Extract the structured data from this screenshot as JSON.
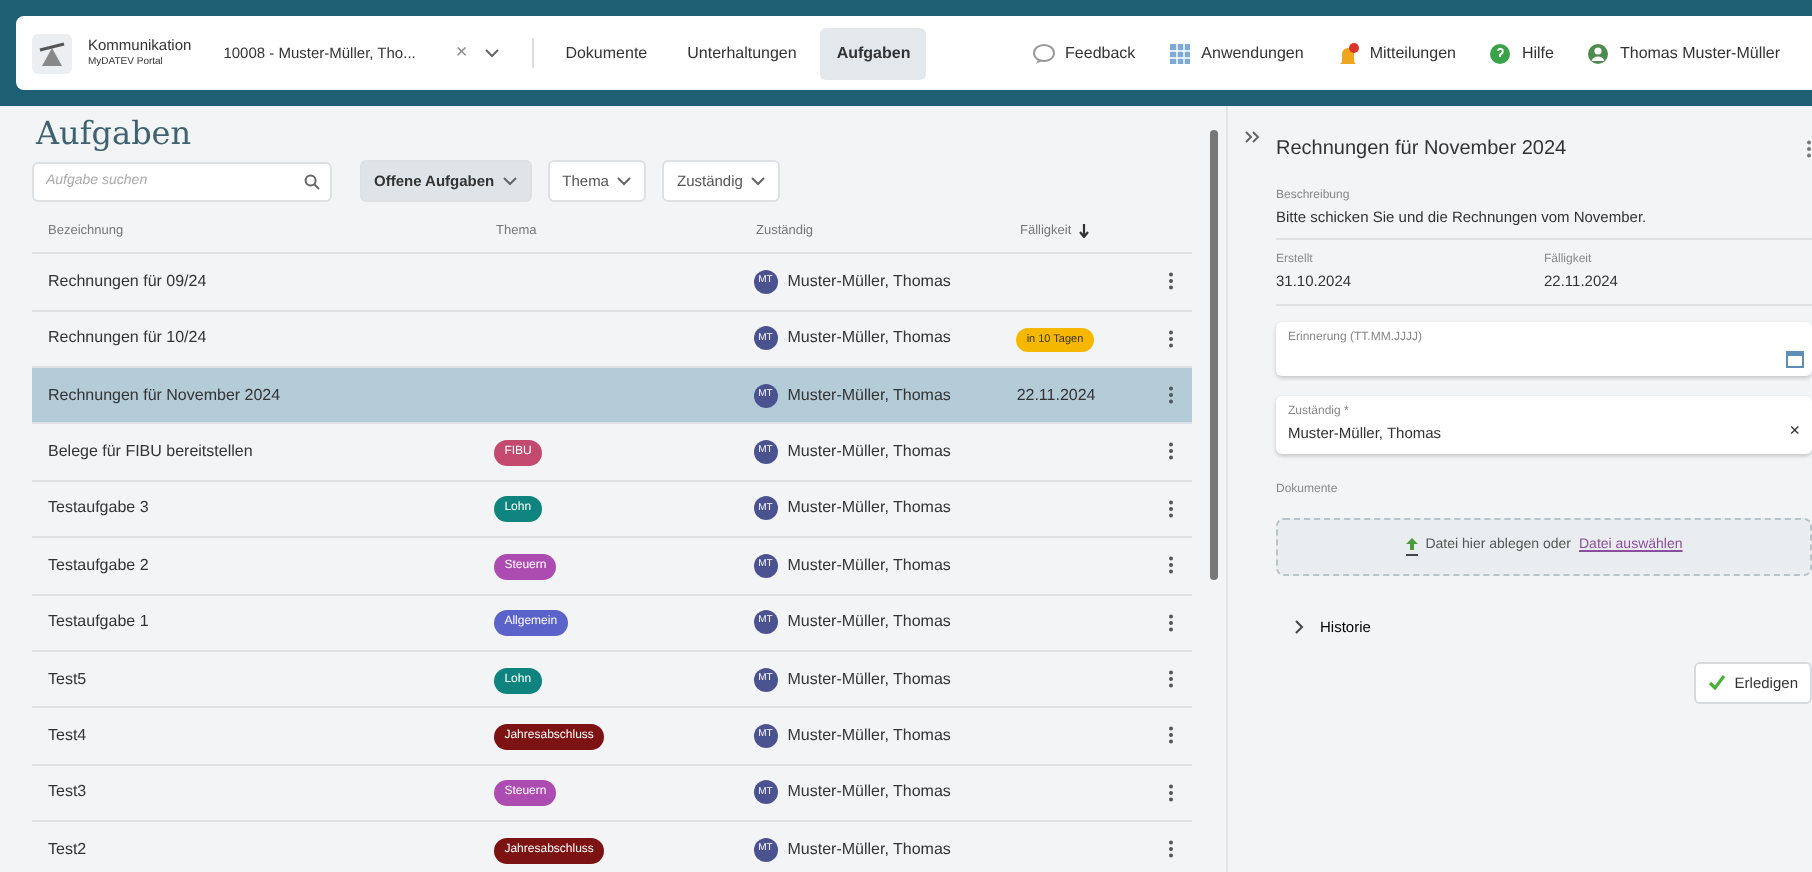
{
  "app": {
    "title": "Kommunikation",
    "subtitle": "MyDATEV Portal"
  },
  "client_selector": {
    "value": "10008 - Muster-Müller, Tho...",
    "clear": "×"
  },
  "nav_tabs": [
    {
      "label": "Dokumente",
      "selected": false
    },
    {
      "label": "Unterhaltungen",
      "selected": false
    },
    {
      "label": "Aufgaben",
      "selected": true
    }
  ],
  "header_actions": [
    {
      "label": "Feedback",
      "kind": "feedback"
    },
    {
      "label": "Anwendungen",
      "kind": "apps"
    },
    {
      "label": "Mitteilungen",
      "kind": "notifications"
    },
    {
      "label": "Hilfe",
      "kind": "help"
    },
    {
      "label": "Thomas Muster-Müller",
      "kind": "user"
    }
  ],
  "page_title": "Aufgaben",
  "search": {
    "placeholder": "Aufgabe suchen"
  },
  "filters": [
    {
      "label": "Offene Aufgaben",
      "selected": true
    },
    {
      "label": "Thema",
      "selected": false
    },
    {
      "label": "Zuständig",
      "selected": false
    }
  ],
  "table": {
    "columns": [
      "Bezeichnung",
      "Thema",
      "Zuständig",
      "Fälligkeit"
    ],
    "rows": [
      {
        "name": "Rechnungen für 09/24",
        "assignee": {
          "initials": "MT",
          "name": "Muster-Müller, Thomas"
        },
        "selected": false
      },
      {
        "name": "Rechnungen für 10/24",
        "assignee": {
          "initials": "MT",
          "name": "Muster-Müller, Thomas"
        },
        "due": {
          "text": "in 10 Tagen",
          "kind": "badge"
        },
        "selected": false
      },
      {
        "name": "Rechnungen für November 2024",
        "assignee": {
          "initials": "MT",
          "name": "Muster-Müller, Thomas"
        },
        "due": {
          "text": "22.11.2024",
          "kind": "plain"
        },
        "selected": true
      },
      {
        "name": "Belege für FIBU bereitstellen",
        "tag": {
          "label": "FIBU",
          "color": "#c4496e"
        },
        "assignee": {
          "initials": "MT",
          "name": "Muster-Müller, Thomas"
        },
        "selected": false
      },
      {
        "name": "Testaufgabe 3",
        "tag": {
          "label": "Lohn",
          "color": "#0f847e"
        },
        "assignee": {
          "initials": "MT",
          "name": "Muster-Müller, Thomas"
        },
        "selected": false
      },
      {
        "name": "Testaufgabe 2",
        "tag": {
          "label": "Steuern",
          "color": "#ad4cb0"
        },
        "assignee": {
          "initials": "MT",
          "name": "Muster-Müller, Thomas"
        },
        "selected": false
      },
      {
        "name": "Testaufgabe 1",
        "tag": {
          "label": "Allgemein",
          "color": "#5b62c9"
        },
        "assignee": {
          "initials": "MT",
          "name": "Muster-Müller, Thomas"
        },
        "selected": false
      },
      {
        "name": "Test5",
        "tag": {
          "label": "Lohn",
          "color": "#0f847e"
        },
        "assignee": {
          "initials": "MT",
          "name": "Muster-Müller, Thomas"
        },
        "selected": false
      },
      {
        "name": "Test4",
        "tag": {
          "label": "Jahresabschluss",
          "color": "#7c1212"
        },
        "assignee": {
          "initials": "MT",
          "name": "Muster-Müller, Thomas"
        },
        "selected": false
      },
      {
        "name": "Test3",
        "tag": {
          "label": "Steuern",
          "color": "#ad4cb0"
        },
        "assignee": {
          "initials": "MT",
          "name": "Muster-Müller, Thomas"
        },
        "selected": false
      },
      {
        "name": "Test2",
        "tag": {
          "label": "Jahresabschluss",
          "color": "#7c1212"
        },
        "assignee": {
          "initials": "MT",
          "name": "Muster-Müller, Thomas"
        },
        "selected": false
      }
    ]
  },
  "detail": {
    "title": "Rechnungen für November 2024",
    "description_label": "Beschreibung",
    "description": "Bitte schicken Sie und die Rechnungen vom November.",
    "created_label": "Erstellt",
    "created": "31.10.2024",
    "due_label": "Fälligkeit",
    "due": "22.11.2024",
    "reminder": {
      "label": "Erinnerung (TT.MM.JJJJ)"
    },
    "assignee": {
      "label": "Zuständig *",
      "value": "Muster-Müller, Thomas",
      "clear": "×"
    },
    "documents_label": "Dokumente",
    "dropzone": {
      "text": "Datei hier ablegen oder",
      "link": "Datei auswählen"
    },
    "history": {
      "label": "Historie",
      "expanded": false
    },
    "done_button": "Erledigen"
  }
}
